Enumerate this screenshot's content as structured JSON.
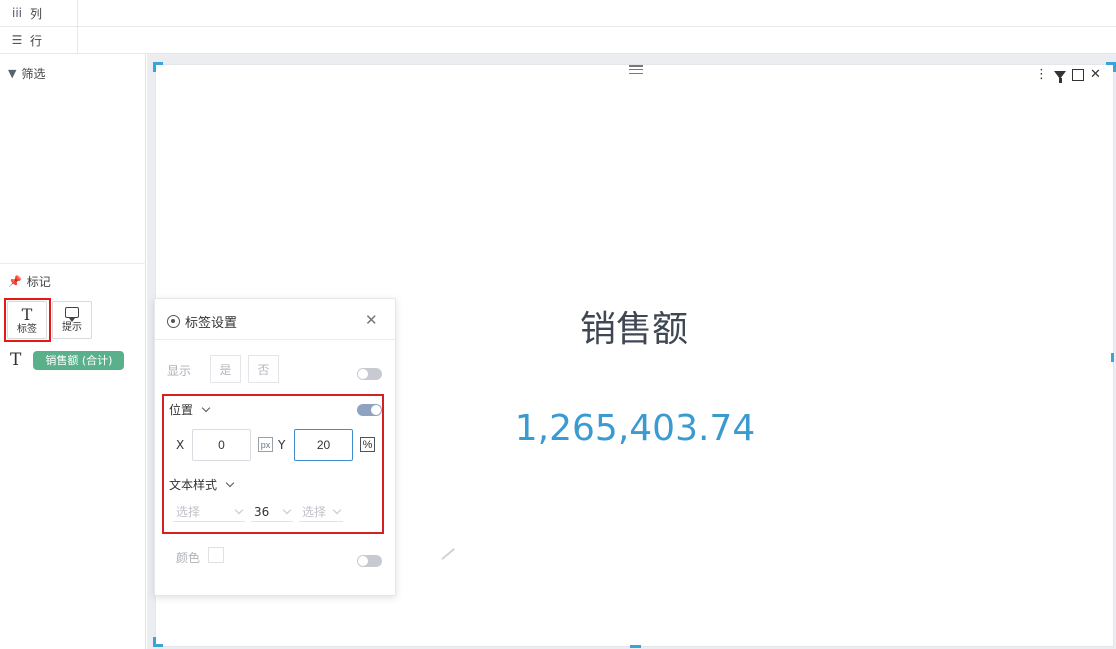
{
  "shelves": {
    "columns_label": "列",
    "rows_label": "行"
  },
  "left_panel": {
    "filter_label": "筛选",
    "marks_label": "标记",
    "mark_types": [
      {
        "label": "标签",
        "glyph": "T"
      },
      {
        "label": "提示"
      }
    ],
    "field_glyph": "T",
    "field_pill": "销售额 (合计)"
  },
  "viz": {
    "title": "销售额",
    "value": "1,265,403.74",
    "tools": {
      "more": "⋮",
      "close": "✕"
    }
  },
  "popup": {
    "title": "标签设置",
    "close": "✕",
    "show_label": "显示",
    "yes": "是",
    "no": "否",
    "position_label": "位置",
    "x_label": "X",
    "x_value": "0",
    "x_unit": "px",
    "y_label": "Y",
    "y_value": "20",
    "y_unit": "%",
    "text_style_label": "文本样式",
    "font_family_placeholder": "选择",
    "font_size": "36",
    "font_weight_placeholder": "选择",
    "color_label": "颜色"
  },
  "toggles": {
    "show": false,
    "position": true,
    "color": false
  },
  "colors": {
    "accent": "#3ba3d8",
    "value_text": "#3b9bd1",
    "pill": "#5ab08b",
    "highlight": "#e01919"
  }
}
